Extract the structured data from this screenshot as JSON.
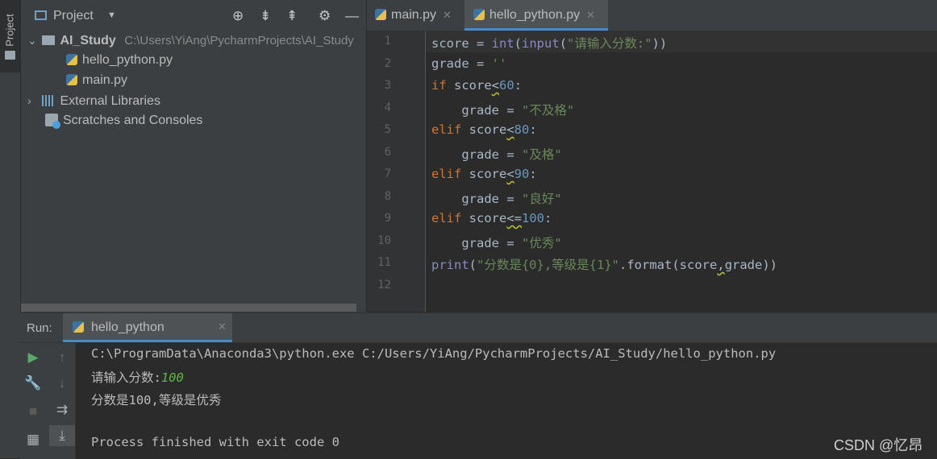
{
  "sidebar": {
    "project_tab": "Project"
  },
  "project": {
    "title": "Project",
    "tree": [
      {
        "label": "AI_Study",
        "path": "C:\\Users\\YiAng\\PycharmProjects\\AI_Study"
      },
      {
        "label": "hello_python.py"
      },
      {
        "label": "main.py"
      },
      {
        "label": "External Libraries"
      },
      {
        "label": "Scratches and Consoles"
      }
    ]
  },
  "editor": {
    "tabs": [
      {
        "label": "main.py"
      },
      {
        "label": "hello_python.py"
      }
    ],
    "line_numbers": [
      "1",
      "2",
      "3",
      "4",
      "5",
      "6",
      "7",
      "8",
      "9",
      "10",
      "11",
      "12"
    ],
    "code": {
      "l1_a": "score",
      "l1_b": " = ",
      "l1_c": "int",
      "l1_d": "(",
      "l1_e": "input",
      "l1_f": "(",
      "l1_g": "\"请输入分数:\"",
      "l1_h": "))",
      "l2_a": "grade = ",
      "l2_b": "''",
      "l3_kw": "if",
      "l3_a": " score",
      "l3_op": "<",
      "l3_num": "60",
      "l3_c": ":",
      "l4_a": "    grade = ",
      "l4_s": "\"不及格\"",
      "l5_kw": "elif",
      "l5_a": " score",
      "l5_op": "<",
      "l5_num": "80",
      "l5_c": ":",
      "l6_a": "    grade = ",
      "l6_s": "\"及格\"",
      "l7_kw": "elif",
      "l7_a": " score",
      "l7_op": "<",
      "l7_num": "90",
      "l7_c": ":",
      "l8_a": "    grade = ",
      "l8_s": "\"良好\"",
      "l9_kw": "elif",
      "l9_a": " score",
      "l9_op": "<=",
      "l9_num": "100",
      "l9_c": ":",
      "l10_a": "    grade = ",
      "l10_s": "\"优秀\"",
      "l11_fn": "print",
      "l11_a": "(",
      "l11_s": "\"分数是{0},等级是{1}\"",
      "l11_b": ".format(score",
      "l11_comma": ",",
      "l11_c": "grade))"
    }
  },
  "run": {
    "label": "Run:",
    "tab": "hello_python",
    "console": {
      "command": "C:\\ProgramData\\Anaconda3\\python.exe C:/Users/YiAng/PycharmProjects/AI_Study/hello_python.py",
      "prompt": "请输入分数:",
      "input": "100",
      "output": "分数是100,等级是优秀",
      "exit": "Process finished with exit code 0"
    }
  },
  "watermark": "CSDN @忆昂"
}
